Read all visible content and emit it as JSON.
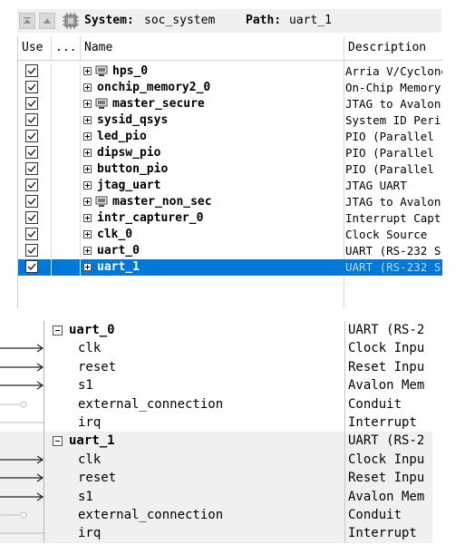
{
  "toolbar": {
    "system_label": "System:",
    "system_value": "soc_system",
    "path_label": "Path:",
    "path_value": "uart_1"
  },
  "columns": {
    "use": "Use",
    "connections": "...",
    "name": "Name",
    "description": "Description"
  },
  "components": [
    {
      "name": "hps_0",
      "description": "Arria V/Cyclone",
      "checked": true,
      "chip_icon": true,
      "selected": false
    },
    {
      "name": "onchip_memory2_0",
      "description": "On-Chip Memory",
      "checked": true,
      "chip_icon": false,
      "selected": false
    },
    {
      "name": "master_secure",
      "description": "JTAG to Avalon",
      "checked": true,
      "chip_icon": true,
      "selected": false
    },
    {
      "name": "sysid_qsys",
      "description": "System ID Peri",
      "checked": true,
      "chip_icon": false,
      "selected": false
    },
    {
      "name": "led_pio",
      "description": "PIO (Parallel",
      "checked": true,
      "chip_icon": false,
      "selected": false
    },
    {
      "name": "dipsw_pio",
      "description": "PIO (Parallel",
      "checked": true,
      "chip_icon": false,
      "selected": false
    },
    {
      "name": "button_pio",
      "description": "PIO (Parallel",
      "checked": true,
      "chip_icon": false,
      "selected": false
    },
    {
      "name": "jtag_uart",
      "description": "JTAG UART",
      "checked": true,
      "chip_icon": false,
      "selected": false
    },
    {
      "name": "master_non_sec",
      "description": "JTAG to Avalon",
      "checked": true,
      "chip_icon": true,
      "selected": false
    },
    {
      "name": "intr_capturer_0",
      "description": "Interrupt Capt",
      "checked": true,
      "chip_icon": false,
      "selected": false
    },
    {
      "name": "clk_0",
      "description": "Clock Source",
      "checked": true,
      "chip_icon": false,
      "selected": false
    },
    {
      "name": "uart_0",
      "description": "UART (RS-232 S",
      "checked": true,
      "chip_icon": false,
      "selected": false
    },
    {
      "name": "uart_1",
      "description": "UART (RS-232 S",
      "checked": true,
      "chip_icon": false,
      "selected": true
    }
  ],
  "detail_groups": [
    {
      "name": "uart_0",
      "description": "UART (RS-2",
      "ports": [
        {
          "name": "clk",
          "description": "Clock Inpu",
          "connection": "arrow"
        },
        {
          "name": "reset",
          "description": "Reset Inpu",
          "connection": "arrow"
        },
        {
          "name": "s1",
          "description": "Avalon Mem",
          "connection": "arrow"
        },
        {
          "name": "external_connection",
          "description": "Conduit",
          "connection": "open"
        },
        {
          "name": "irq",
          "description": "Interrupt",
          "connection": "line"
        }
      ]
    },
    {
      "name": "uart_1",
      "description": "UART (RS-2",
      "ports": [
        {
          "name": "clk",
          "description": "Clock Inpu",
          "connection": "arrow"
        },
        {
          "name": "reset",
          "description": "Reset Inpu",
          "connection": "arrow"
        },
        {
          "name": "s1",
          "description": "Avalon Mem",
          "connection": "arrow"
        },
        {
          "name": "external_connection",
          "description": "Conduit",
          "connection": "open"
        },
        {
          "name": "irq",
          "description": "Interrupt",
          "connection": "line"
        }
      ]
    }
  ],
  "colors": {
    "selection": "#0078d7",
    "shaded_row": "#f0f0f0"
  }
}
